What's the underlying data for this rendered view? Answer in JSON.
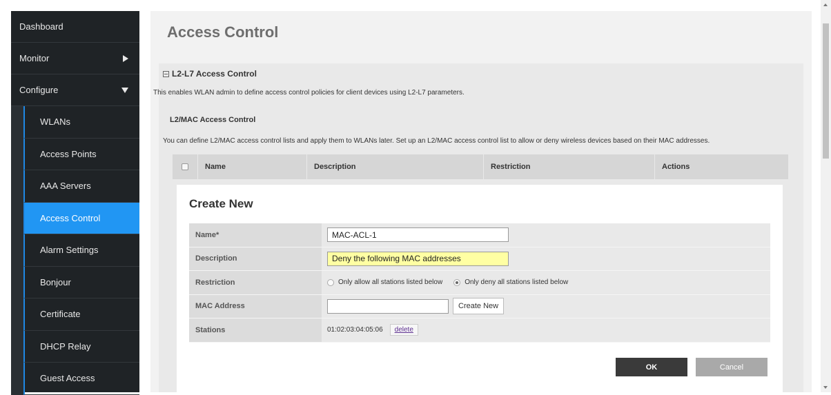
{
  "sidebar": {
    "items": [
      {
        "label": "Dashboard"
      },
      {
        "label": "Monitor"
      },
      {
        "label": "Configure"
      }
    ],
    "sub_items": [
      {
        "label": "WLANs"
      },
      {
        "label": "Access Points"
      },
      {
        "label": "AAA Servers"
      },
      {
        "label": "Access Control"
      },
      {
        "label": "Alarm Settings"
      },
      {
        "label": "Bonjour"
      },
      {
        "label": "Certificate"
      },
      {
        "label": "DHCP Relay"
      },
      {
        "label": "Guest Access"
      }
    ],
    "active_sub_item": "Access Control"
  },
  "page": {
    "title": "Access Control"
  },
  "section": {
    "title": "L2-L7 Access Control",
    "description": "This enables WLAN admin to define access control policies for client devices using L2-L7 parameters.",
    "subsection_title": "L2/MAC Access Control",
    "subsection_description": "You can define L2/MAC access control lists and apply them to WLANs later. Set up an L2/MAC access control list to allow or deny wireless devices based on their MAC addresses."
  },
  "table": {
    "columns": [
      "Name",
      "Description",
      "Restriction",
      "Actions"
    ]
  },
  "create_form": {
    "title": "Create New",
    "name_label": "Name*",
    "name_value": "MAC-ACL-1",
    "description_label": "Description",
    "description_value": "Deny the following MAC addresses",
    "restriction_label": "Restriction",
    "restriction_options": [
      {
        "label": "Only allow all stations listed below",
        "selected": false
      },
      {
        "label": "Only deny all stations listed below",
        "selected": true
      }
    ],
    "mac_label": "MAC Address",
    "mac_value": "",
    "create_new_button": "Create New",
    "stations_label": "Stations",
    "stations": [
      {
        "mac": "01:02:03:04:05:06",
        "delete_label": "delete"
      }
    ],
    "ok_label": "OK",
    "cancel_label": "Cancel"
  },
  "colors": {
    "sidebar_bg": "#1f2326",
    "active_item": "#2196f3",
    "highlight_input": "#ffffa3",
    "ok_button": "#3a3a3a",
    "cancel_button": "#a9a9a9"
  }
}
